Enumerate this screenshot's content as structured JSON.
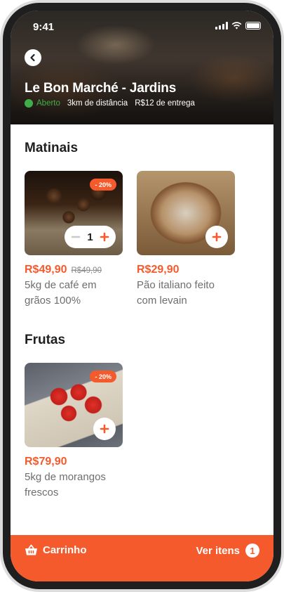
{
  "status_bar": {
    "time": "9:41"
  },
  "store": {
    "name": "Le Bon Marché - Jardins",
    "status": "Aberto",
    "distance": "3km de distância",
    "delivery_fee": "R$12 de entrega"
  },
  "sections": [
    {
      "title": "Matinais",
      "items": [
        {
          "discount": "- 20%",
          "quantity": "1",
          "price": "R$49,90",
          "old_price": "R$49,90",
          "description": "5kg de café em grãos 100%",
          "image_icon": "coffee-beans-photo"
        },
        {
          "price": "R$29,90",
          "description": "Pão italiano feito com levain",
          "image_icon": "bread-loaf-photo"
        }
      ]
    },
    {
      "title": "Frutas",
      "items": [
        {
          "discount": "- 20%",
          "price": "R$79,90",
          "description": "5kg de morangos frescos",
          "image_icon": "strawberries-photo"
        }
      ]
    }
  ],
  "bottom_bar": {
    "cart_label": "Carrinho",
    "see_items_label": "Ver itens",
    "item_count": "1"
  },
  "colors": {
    "accent": "#f55a2c",
    "open_green": "#3fae49"
  }
}
